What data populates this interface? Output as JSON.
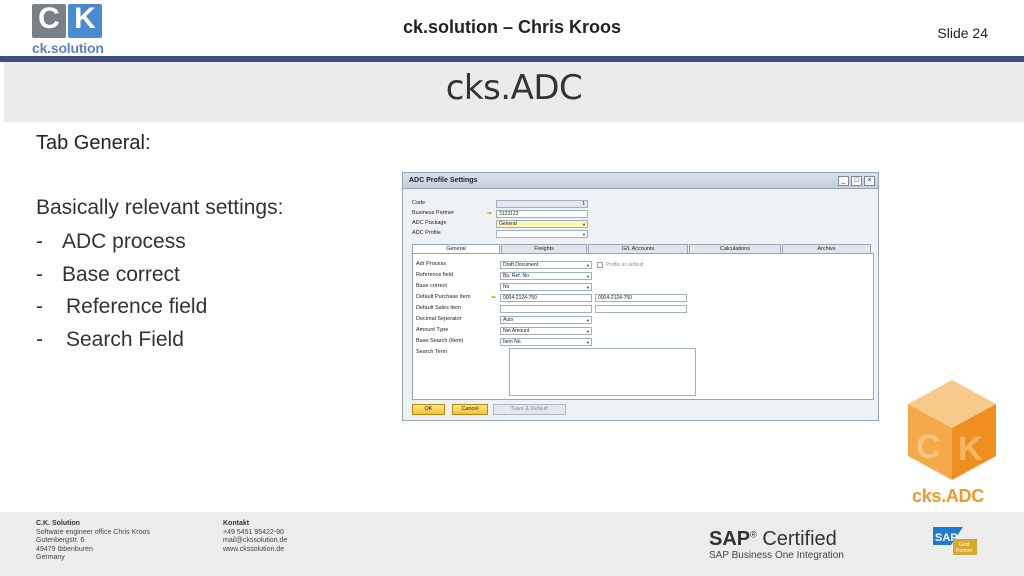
{
  "header": {
    "logo": {
      "letter_left": "C",
      "letter_right": "K",
      "wordmark": "ck.solution"
    },
    "title": "ck.solution – Chris Kroos",
    "slide_number": "Slide 24"
  },
  "page_title": "cks.ADC",
  "content": {
    "tab_heading": "Tab General:",
    "intro": "Basically relevant settings:",
    "bullets": [
      {
        "dash": "-",
        "text": "ADC process"
      },
      {
        "dash": "-",
        "text": "Base correct"
      },
      {
        "dash": "-",
        "text": "Reference field"
      },
      {
        "dash": "-",
        "text": "Search Field"
      }
    ]
  },
  "dialog": {
    "title": "ADC Profile Settings",
    "window_buttons": [
      "_",
      "□",
      "×"
    ],
    "header_fields": [
      {
        "label": "Code",
        "value": "1"
      },
      {
        "label": "Business Partner",
        "value": "3123123"
      },
      {
        "label": "ADC Package",
        "value": "General"
      },
      {
        "label": "ADC Profile",
        "value": ""
      }
    ],
    "tabs": [
      "General",
      "Freights",
      "G/L Accounts",
      "Calculations",
      "Archive"
    ],
    "active_tab": "General",
    "general_fields": [
      {
        "label": "Adr Process",
        "value": "Draft Document"
      },
      {
        "label": "Reference field",
        "value": "Bp. Ref. No."
      },
      {
        "label": "Base correct",
        "value": "No"
      },
      {
        "label": "Default Purchase Item",
        "value": "0004-2124-750",
        "value2": "0004-2124-750"
      },
      {
        "label": "Default Sales Item",
        "value": "",
        "value2": ""
      },
      {
        "label": "Decimal Seperator",
        "value": "Auto"
      },
      {
        "label": "Amount Type",
        "value": "Net Amount"
      },
      {
        "label": "Base Search (Item)",
        "value": "Item No."
      },
      {
        "label": "Search Term",
        "value": ""
      }
    ],
    "checkbox_label": "Profile as default",
    "buttons": {
      "ok": "OK",
      "cancel": "Cancel",
      "save_default": "Save & Default"
    }
  },
  "product_badge": {
    "label": "cks.ADC"
  },
  "footer": {
    "company": {
      "heading": "C.K. Solution",
      "lines": [
        "Software engineer office Chris Kroos",
        "Gutenbergstr. 6",
        "49479 Ibbenburen",
        "Germany"
      ]
    },
    "contact": {
      "heading": "Kontakt",
      "lines": [
        "+49 5451 95422-90",
        "mail@ckssolution.de",
        "www.ckssolution.de"
      ]
    },
    "certification": {
      "brand": "SAP",
      "registered": "®",
      "certified": " Certified",
      "subtitle": "SAP Business One Integration"
    },
    "partner_badge": {
      "brand": "SAP",
      "level": "Gold",
      "label": "Partner"
    }
  },
  "colors": {
    "header_rule": "#3f4f7a",
    "title_band": "#ebebeb",
    "cube_orange": "#ef9a2a",
    "sap_blue": "#1f7bd1",
    "dialog_button_yellow": "#f3c332"
  }
}
